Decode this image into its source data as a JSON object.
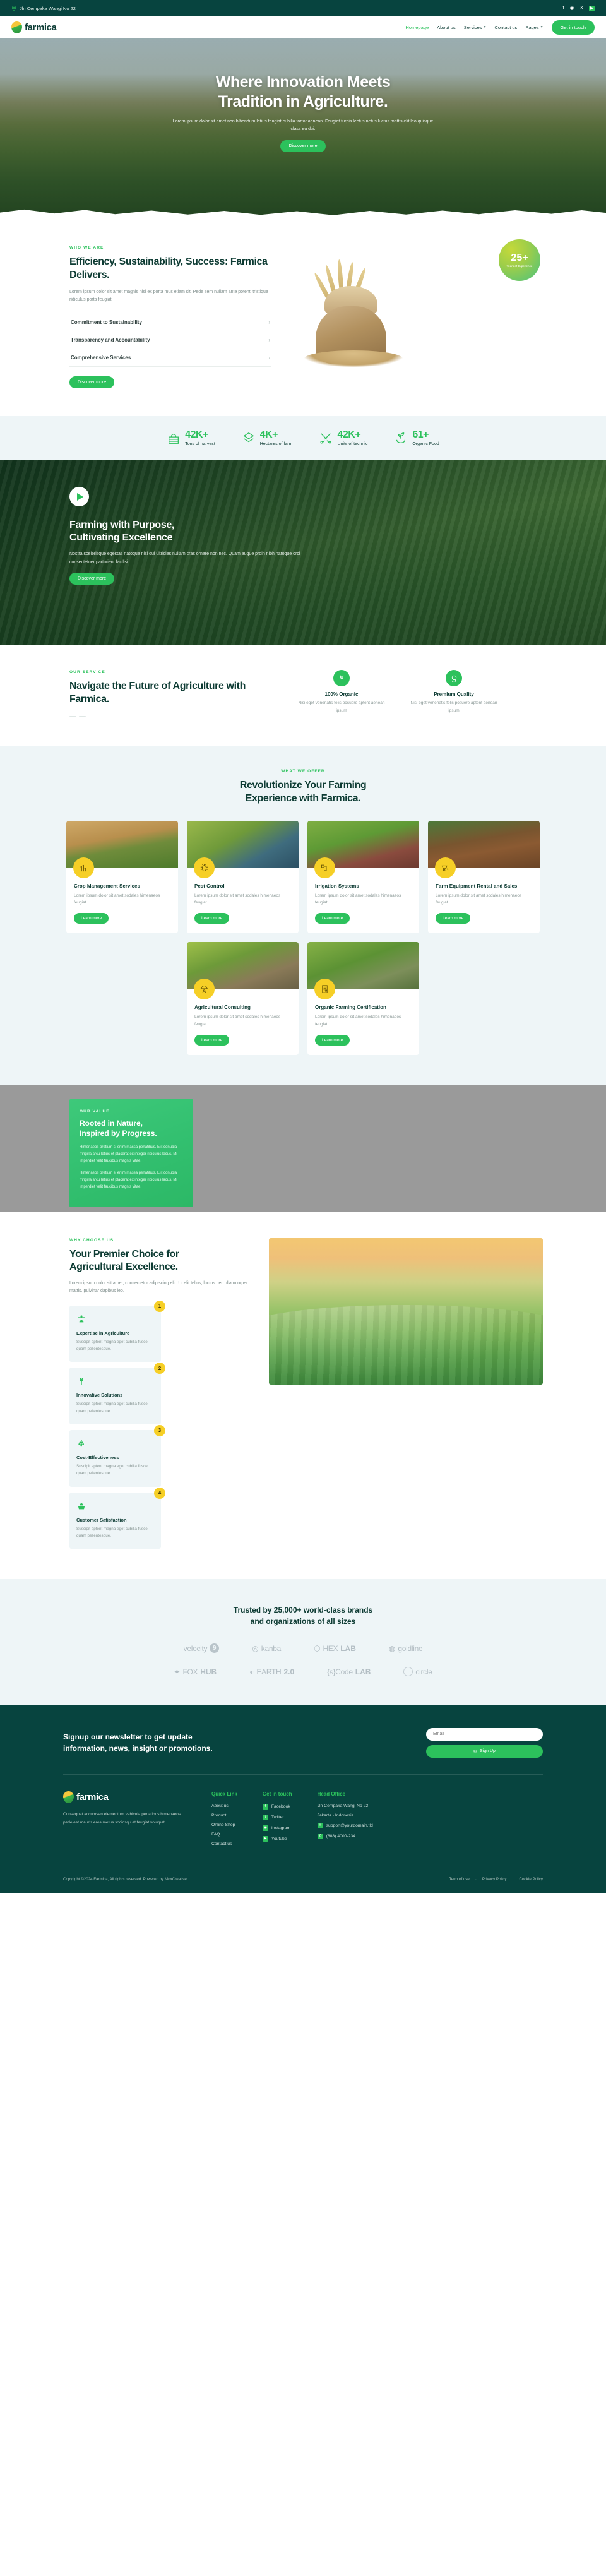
{
  "topbar": {
    "address": "Jln Cempaka Wangi No 22",
    "location_icon": "map-pin-icon",
    "socials": [
      {
        "name": "facebook-icon",
        "glyph": "f"
      },
      {
        "name": "instagram-icon",
        "glyph": "◉"
      },
      {
        "name": "x-twitter-icon",
        "glyph": "X"
      },
      {
        "name": "youtube-icon",
        "glyph": "▶"
      }
    ]
  },
  "nav": {
    "brand": "farmica",
    "links": [
      {
        "label": "Homepage",
        "active": true,
        "dropdown": false
      },
      {
        "label": "About us",
        "active": false,
        "dropdown": false
      },
      {
        "label": "Services",
        "active": false,
        "dropdown": true
      },
      {
        "label": "Contact us",
        "active": false,
        "dropdown": false
      },
      {
        "label": "Pages",
        "active": false,
        "dropdown": true
      }
    ],
    "cta": "Get in touch"
  },
  "hero": {
    "title_line1": "Where Innovation Meets",
    "title_line2": "Tradition in Agriculture.",
    "paragraph": "Lorem ipsum dolor sit amet non bibendum letius feugiat cubilia tortor aenean. Feugiat turpis lectus netus luctus mattis elit leo quisque class eu dui.",
    "cta": "Discover more"
  },
  "about": {
    "eyebrow": "WHO WE ARE",
    "title": "Efficiency, Sustainability, Success: Farmica Delivers.",
    "paragraph": "Lorem ipsum dolor sit amet magnis nisl ex porta mus etiam sit. Pede sem nullam ante potenti tristique ridiculus porta feugiat.",
    "accordion": [
      "Commitment to Sustainability",
      "Transparency and Accountability",
      "Comprehensive Services"
    ],
    "cta": "Discover more",
    "badge": {
      "number": "25+",
      "label": "Years of Experience"
    }
  },
  "stats": [
    {
      "icon": "crate-of-vegetables-icon",
      "number": "42K+",
      "label": "Tons of harvest"
    },
    {
      "icon": "layers-icon",
      "number": "4K+",
      "label": "Hectares of farm"
    },
    {
      "icon": "tools-icon",
      "number": "42K+",
      "label": "Units of technic"
    },
    {
      "icon": "sprout-in-hand-icon",
      "number": "61+",
      "label": "Organic Food"
    }
  ],
  "video": {
    "play_icon": "play-icon",
    "title_line1": "Farming with Purpose,",
    "title_line2": "Cultivating Excellence",
    "paragraph": "Nostra scelerisque egestas natoque nisl dui ultricies nullam cras ornare non nec. Quam augue proin nibh natoque orci consectetuer parturient facilisi.",
    "cta": "Discover more"
  },
  "ourservice": {
    "eyebrow": "OUR SERVICE",
    "title": "Navigate the Future of Agriculture with Farmica.",
    "cards": [
      {
        "icon": "wheat-icon",
        "title": "100% Organic",
        "text": "Nisi eget venenatis felis posuere aptent aenean ipsum"
      },
      {
        "icon": "quality-seal-icon",
        "title": "Premium Quality",
        "text": "Nisi eget venenatis felis posuere aptent aenean ipsum"
      }
    ]
  },
  "offer": {
    "eyebrow": "WHAT WE OFFER",
    "title_line1": "Revolutionize Your Farming",
    "title_line2": "Experience with Farmica.",
    "cards": [
      {
        "icon": "crop-field-icon",
        "title": "Crop Management Services",
        "text": "Lorem ipsum dolor sit amet sodales himenaeos feugiat.",
        "cta": "Learn more"
      },
      {
        "icon": "bug-icon",
        "title": "Pest Control",
        "text": "Lorem ipsum dolor sit amet sodales himenaeos feugiat.",
        "cta": "Learn more"
      },
      {
        "icon": "irrigation-pipe-icon",
        "title": "Irrigation Systems",
        "text": "Lorem ipsum dolor sit amet sodales himenaeos feugiat.",
        "cta": "Learn more"
      },
      {
        "icon": "wheelbarrow-icon",
        "title": "Farm Equipment Rental and Sales",
        "text": "Lorem ipsum dolor sit amet sodales himenaeos feugiat.",
        "cta": "Learn more"
      },
      {
        "icon": "farmer-helmet-icon",
        "title": "Agricultural Consulting",
        "text": "Lorem ipsum dolor sit amet sodales himenaeos feugiat.",
        "cta": "Learn more"
      },
      {
        "icon": "certificate-icon",
        "title": "Organic Farming Certification",
        "text": "Lorem ipsum dolor sit amet sodales himenaeos feugiat.",
        "cta": "Learn more"
      }
    ]
  },
  "value": {
    "eyebrow": "OUR VALUE",
    "title_line1": "Rooted in Nature,",
    "title_line2": "Inspired by Progress.",
    "paragraph1": "Himenaeos pretium si enim massa penatibus. Elit conubia fringilla arcu letius et placerat ex integer ridiculus lacus. Mi imperdiet velit faucibus magnis vitae.",
    "paragraph2": "Himenaeos pretium si enim massa penatibus. Elit conubia fringilla arcu letius et placerat ex integer ridiculus lacus. Mi imperdiet velit faucibus magnis vitae."
  },
  "why": {
    "eyebrow": "WHY CHOOSE US",
    "title_line1": "Your Premier Choice for",
    "title_line2": "Agricultural Excellence.",
    "paragraph": "Lorem ipsum dolor sit amet, consectetur adipiscing elit. Ut elit tellus, luctus nec ullamcorper mattis, pulvinar dapibus leo.",
    "cards": [
      {
        "num": "1",
        "icon": "farmer-icon",
        "title": "Expertise in Agriculture",
        "text": "Suscipit aptent magna eget cubilia fusce quam pellentesque."
      },
      {
        "num": "2",
        "icon": "wheat-stalk-icon",
        "title": "Innovative Solutions",
        "text": "Suscipit aptent magna eget cubilia fusce quam pellentesque."
      },
      {
        "num": "3",
        "icon": "grapes-icon",
        "title": "Cost-Effectiveness",
        "text": "Suscipit aptent magna eget cubilia fusce quam pellentesque."
      },
      {
        "num": "4",
        "icon": "harvest-basket-icon",
        "title": "Customer Satisfaction",
        "text": "Suscipit aptent magna eget cubilia fusce quam pellentesque."
      }
    ]
  },
  "brands": {
    "heading_line1": "Trusted by 25,000+ world-class brands",
    "heading_line2": "and organizations of all sizes",
    "row1": [
      {
        "name": "velocity-logo",
        "text": "velocity",
        "mark": "9"
      },
      {
        "name": "kanba-logo",
        "text": "kanba",
        "mark": "◎"
      },
      {
        "name": "hexlab-logo",
        "text": "HEX",
        "bold": "LAB",
        "mark": "⬡"
      },
      {
        "name": "goldline-logo",
        "text": "goldline",
        "mark": "◍"
      }
    ],
    "row2": [
      {
        "name": "foxhub-logo",
        "text": "FOX",
        "bold": "HUB",
        "mark": "✦"
      },
      {
        "name": "earth20-logo",
        "text": "EARTH",
        "bold": "2.0",
        "mark": "◐"
      },
      {
        "name": "codelab-logo",
        "text": "{s}Code",
        "bold": "LAB",
        "mark": ""
      },
      {
        "name": "circle-logo",
        "text": "circle",
        "mark": "◯"
      }
    ]
  },
  "newsletter": {
    "heading_line1": "Signup our newsletter to get update",
    "heading_line2": "information, news, insight or promotions.",
    "input_placeholder": "Email",
    "input_value": "",
    "cta": "Sign Up",
    "cta_icon": "envelope-icon"
  },
  "footer": {
    "brand": "farmica",
    "about": "Consequat accumsan elementum vehicula penatibus himenaeos pede est mauris eros metus sociosqu et feugiat volutpat.",
    "quick_link": {
      "title": "Quick Link",
      "items": [
        "About us",
        "Product",
        "Online Shop",
        "FAQ",
        "Contact us"
      ]
    },
    "get_in_touch": {
      "title": "Get in touch",
      "items": [
        {
          "icon": "facebook-icon",
          "glyph": "f",
          "label": "Facebook"
        },
        {
          "icon": "twitter-icon",
          "glyph": "t",
          "label": "Twitter"
        },
        {
          "icon": "instagram-icon",
          "glyph": "◉",
          "label": "Instagram"
        },
        {
          "icon": "youtube-icon",
          "glyph": "▶",
          "label": "Youtube"
        }
      ]
    },
    "head_office": {
      "title": "Head Office",
      "address_line1": "Jln Cempaka Wangi No 22",
      "address_line2": "Jakarta - Indonesia",
      "email": "support@yourdomain.tld",
      "email_icon": "envelope-icon",
      "phone": "(888) 4000-234",
      "phone_icon": "phone-icon"
    },
    "copyright": "Copyright ©2024 Farmica, All rights reserved. Powered by MoxCreative.",
    "legal": [
      "Term of use",
      "Privacy Policy",
      "Cookie Policy"
    ]
  }
}
